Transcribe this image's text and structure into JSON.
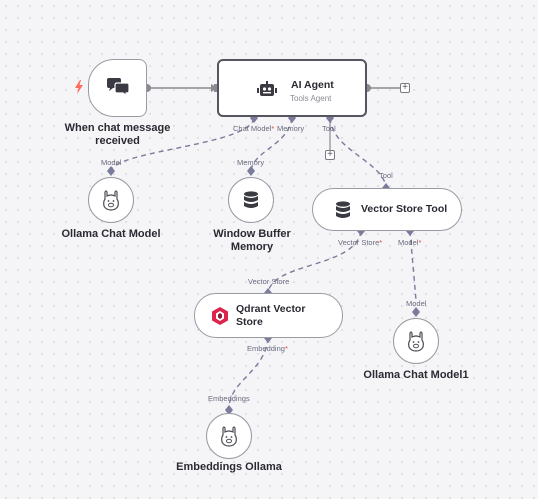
{
  "nodes": {
    "trigger": {
      "label": "When chat message received"
    },
    "agent": {
      "title": "AI Agent",
      "subtitle": "Tools Agent"
    },
    "ollama_chat": {
      "label": "Ollama Chat Model"
    },
    "memory": {
      "label_line1": "Window Buffer",
      "label_line2": "Memory"
    },
    "vector_tool": {
      "title": "Vector Store Tool"
    },
    "qdrant": {
      "title_line1": "Qdrant Vector",
      "title_line2": "Store"
    },
    "ollama_chat1": {
      "label": "Ollama Chat Model1"
    },
    "embeddings": {
      "label": "Embeddings Ollama"
    }
  },
  "connectors": {
    "agent_chat_model": "Chat Model",
    "agent_memory": "Memory",
    "agent_tool": "Tool",
    "ollama_model": "Model",
    "memory_memory": "Memory",
    "vt_tool": "Tool",
    "vt_vector_store": "Vector Store",
    "vt_model": "Model",
    "qdrant_vector_store": "Vector Store",
    "qdrant_embedding": "Embedding",
    "ollama1_model": "Model",
    "embeddings_label": "Embeddings",
    "required_mark": "*"
  },
  "buttons": {
    "plus": "+"
  },
  "colors": {
    "trigger_bolt": "#ff6d5a",
    "connector": "#7b7b9c",
    "qdrant_red": "#dc244c",
    "node_border": "#9a9aa3"
  },
  "icons": {
    "trigger": "chat-bubbles-icon",
    "agent": "robot-icon",
    "memory": "database-icon",
    "vector_tool": "database-icon",
    "qdrant": "qdrant-logo-icon",
    "ollama": "llama-icon"
  }
}
